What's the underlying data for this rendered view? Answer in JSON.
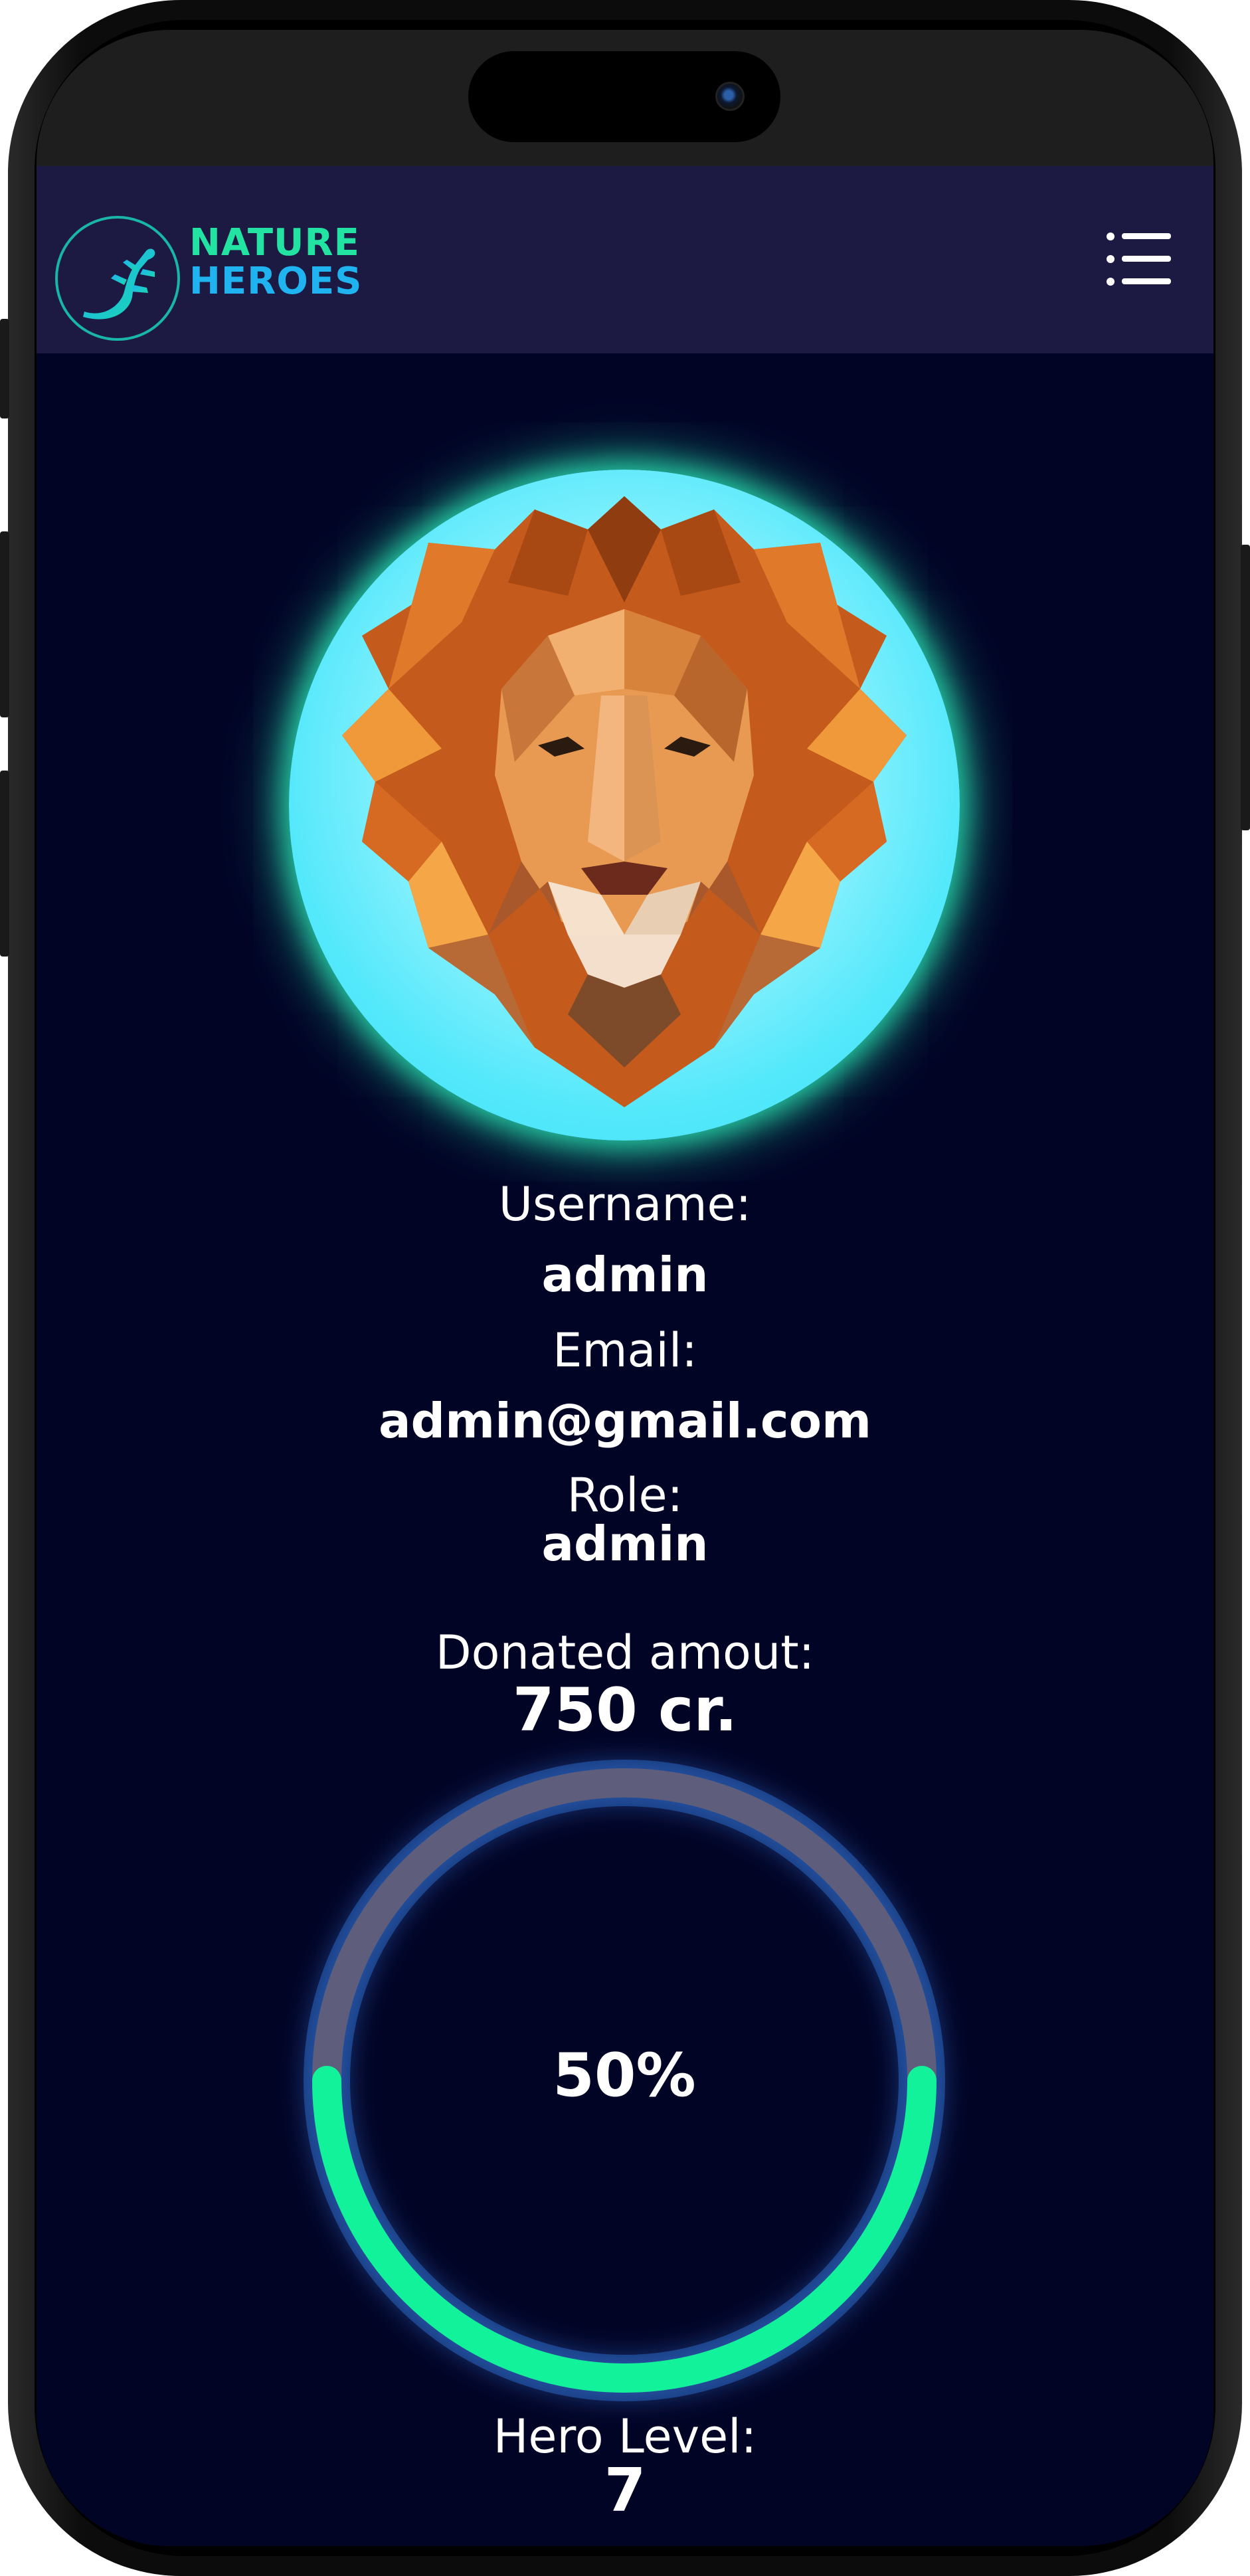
{
  "brand": {
    "line1": "NATURE",
    "line2": "HEROES",
    "logo_icon": "lizard-icon",
    "colors": {
      "line1": "#23e3a3",
      "line2": "#1fb4f0",
      "ring": "#19b6a7"
    }
  },
  "nav": {
    "menu_icon": "list-menu-icon"
  },
  "profile": {
    "avatar_icon": "lion-avatar",
    "username_label": "Username:",
    "username": "admin",
    "email_label": "Email:",
    "email": "admin@gmail.com",
    "role_label": "Role:",
    "role": "admin",
    "donated_label": "Donated amout:",
    "donated_value": "750 cr.",
    "progress": {
      "value": 50,
      "text": "50%",
      "track_color": "#5e5e7c",
      "fill_color": "#12f29a"
    },
    "hero_level_label": "Hero Level:",
    "hero_level": "7"
  },
  "theme": {
    "background": "#020426",
    "navbar": "#1c1a43"
  }
}
